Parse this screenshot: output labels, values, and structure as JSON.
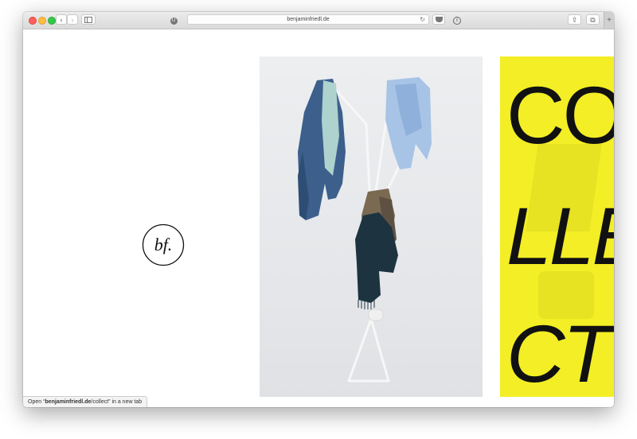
{
  "browser": {
    "url": "benjaminfriedl.de",
    "back_glyph": "‹",
    "forward_glyph": "›",
    "reload_glyph": "↻",
    "share_glyph": "⇪",
    "tabs_glyph": "⧉",
    "new_tab_glyph": "+",
    "extension_glyph": "U"
  },
  "page": {
    "logo_text": "bf.",
    "collect_words": [
      "CO",
      "LLE",
      "CT"
    ],
    "accent_color": "#f3ee25"
  },
  "status_bar": {
    "prefix": "Open “",
    "link_host": "benjaminfriedl.de",
    "link_path": "/collect",
    "suffix": "” in a new tab"
  }
}
